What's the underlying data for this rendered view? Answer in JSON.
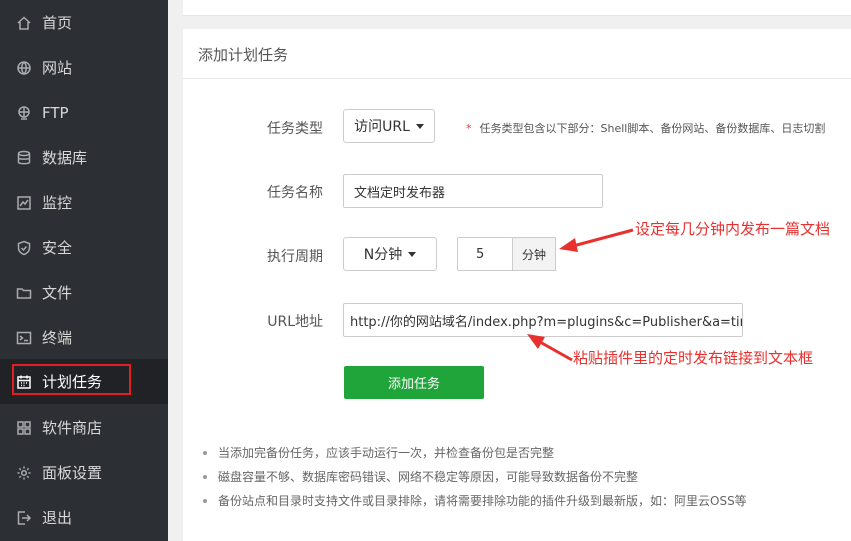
{
  "sidebar": {
    "items": [
      {
        "label": "首页",
        "icon": "home-icon"
      },
      {
        "label": "网站",
        "icon": "globe-icon"
      },
      {
        "label": "FTP",
        "icon": "ftp-icon"
      },
      {
        "label": "数据库",
        "icon": "database-icon"
      },
      {
        "label": "监控",
        "icon": "monitor-icon"
      },
      {
        "label": "安全",
        "icon": "shield-icon"
      },
      {
        "label": "文件",
        "icon": "folder-icon"
      },
      {
        "label": "终端",
        "icon": "terminal-icon"
      },
      {
        "label": "计划任务",
        "icon": "calendar-icon",
        "active": true
      },
      {
        "label": "软件商店",
        "icon": "apps-icon"
      },
      {
        "label": "面板设置",
        "icon": "gear-icon"
      },
      {
        "label": "退出",
        "icon": "logout-icon"
      }
    ]
  },
  "panel": {
    "title": "添加计划任务",
    "task_type": {
      "label": "任务类型",
      "value": "访问URL"
    },
    "task_type_hint": {
      "star": "*",
      "text": "任务类型包含以下部分：Shell脚本、备份网站、备份数据库、日志切割"
    },
    "task_name": {
      "label": "任务名称",
      "value": "文档定时发布器"
    },
    "cycle": {
      "label": "执行周期",
      "value": "N分钟",
      "minutes": "5",
      "unit": "分钟"
    },
    "url": {
      "label": "URL地址",
      "value": "http://你的网站域名/index.php?m=plugins&c=Publisher&a=time_server"
    },
    "submit_label": "添加任务",
    "notes": [
      "当添加完备份任务，应该手动运行一次，并检查备份包是否完整",
      "磁盘容量不够、数据库密码错误、网络不稳定等原因，可能导致数据备份不完整",
      "备份站点和目录时支持文件或目录排除，请将需要排除功能的插件升级到最新版，如：阿里云OSS等"
    ]
  },
  "annotations": {
    "cycle_note": "设定每几分钟内发布一篇文档",
    "url_note": "粘贴插件里的定时发布链接到文本框"
  },
  "colors": {
    "accent": "#20a53a",
    "annotation": "#e8312f",
    "sidebar": "#2c2f33"
  }
}
